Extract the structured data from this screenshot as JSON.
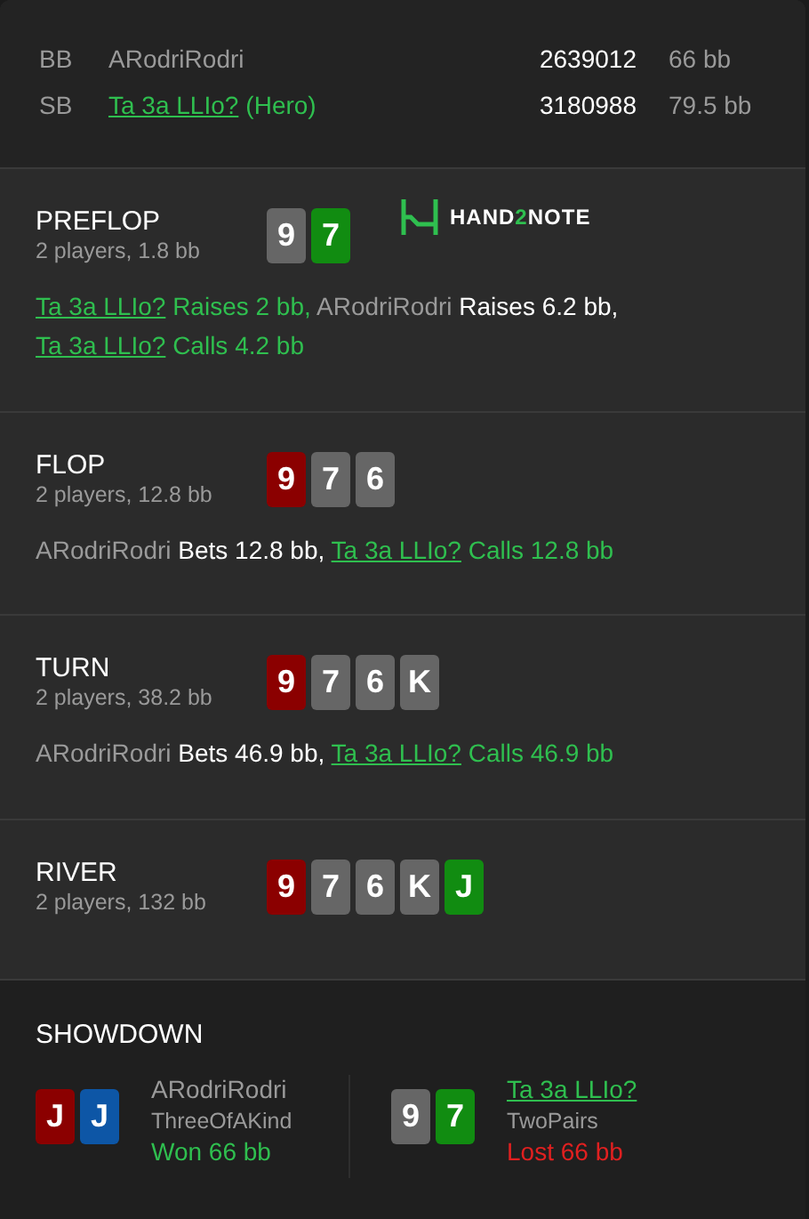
{
  "players": [
    {
      "position": "BB",
      "name": "ARodriRodri",
      "hero": false,
      "stack": "2639012",
      "stack_bb": "66 bb"
    },
    {
      "position": "SB",
      "name": "Ta 3a LLIo?",
      "hero": true,
      "hero_label": "(Hero)",
      "stack": "3180988",
      "stack_bb": "79.5 bb"
    }
  ],
  "streets": [
    {
      "title": "PREFLOP",
      "subtitle": "2 players, 1.8 bb",
      "logo": {
        "parts": [
          {
            "text": "HAND",
            "accent": false
          },
          {
            "text": "2",
            "accent": true
          },
          {
            "text": "NOTE",
            "accent": false
          }
        ]
      },
      "cards": [
        {
          "rank": "9",
          "color": "#666666"
        },
        {
          "rank": "7",
          "color": "#118c11"
        }
      ],
      "actions": [
        {
          "player": "Ta 3a LLIo?",
          "hero": true,
          "action": "Raises 2 bb,"
        },
        {
          "player": "ARodriRodri",
          "hero": false,
          "action": "Raises 6.2 bb,"
        },
        {
          "player": "Ta 3a LLIo?",
          "hero": true,
          "action": "Calls 4.2 bb"
        }
      ]
    },
    {
      "title": "FLOP",
      "subtitle": "2 players, 12.8 bb",
      "cards": [
        {
          "rank": "9",
          "color": "#8b0000"
        },
        {
          "rank": "7",
          "color": "#666666"
        },
        {
          "rank": "6",
          "color": "#666666"
        }
      ],
      "actions": [
        {
          "player": "ARodriRodri",
          "hero": false,
          "action": "Bets 12.8 bb,"
        },
        {
          "player": "Ta 3a LLIo?",
          "hero": true,
          "action": "Calls 12.8 bb"
        }
      ]
    },
    {
      "title": "TURN",
      "subtitle": "2 players, 38.2 bb",
      "cards": [
        {
          "rank": "9",
          "color": "#8b0000"
        },
        {
          "rank": "7",
          "color": "#666666"
        },
        {
          "rank": "6",
          "color": "#666666"
        },
        {
          "rank": "K",
          "color": "#666666"
        }
      ],
      "actions": [
        {
          "player": "ARodriRodri",
          "hero": false,
          "action": "Bets 46.9 bb,"
        },
        {
          "player": "Ta 3a LLIo?",
          "hero": true,
          "action": "Calls 46.9 bb"
        }
      ]
    },
    {
      "title": "RIVER",
      "subtitle": "2 players, 132 bb",
      "cards": [
        {
          "rank": "9",
          "color": "#8b0000"
        },
        {
          "rank": "7",
          "color": "#666666"
        },
        {
          "rank": "6",
          "color": "#666666"
        },
        {
          "rank": "K",
          "color": "#666666"
        },
        {
          "rank": "J",
          "color": "#118c11"
        }
      ]
    }
  ],
  "showdown": {
    "title": "SHOWDOWN",
    "players": [
      {
        "name": "ARodriRodri",
        "hero": false,
        "hand": "ThreeOfAKind",
        "won": true,
        "result": "Won 66 bb",
        "cards": [
          {
            "rank": "J",
            "color": "#8b0000"
          },
          {
            "rank": "J",
            "color": "#0d56a6"
          }
        ]
      },
      {
        "name": "Ta 3a LLIo?",
        "hero": true,
        "hand": "TwoPairs",
        "won": false,
        "result": "Lost 66 bb",
        "cards": [
          {
            "rank": "9",
            "color": "#666666"
          },
          {
            "rank": "7",
            "color": "#118c11"
          }
        ]
      }
    ]
  }
}
